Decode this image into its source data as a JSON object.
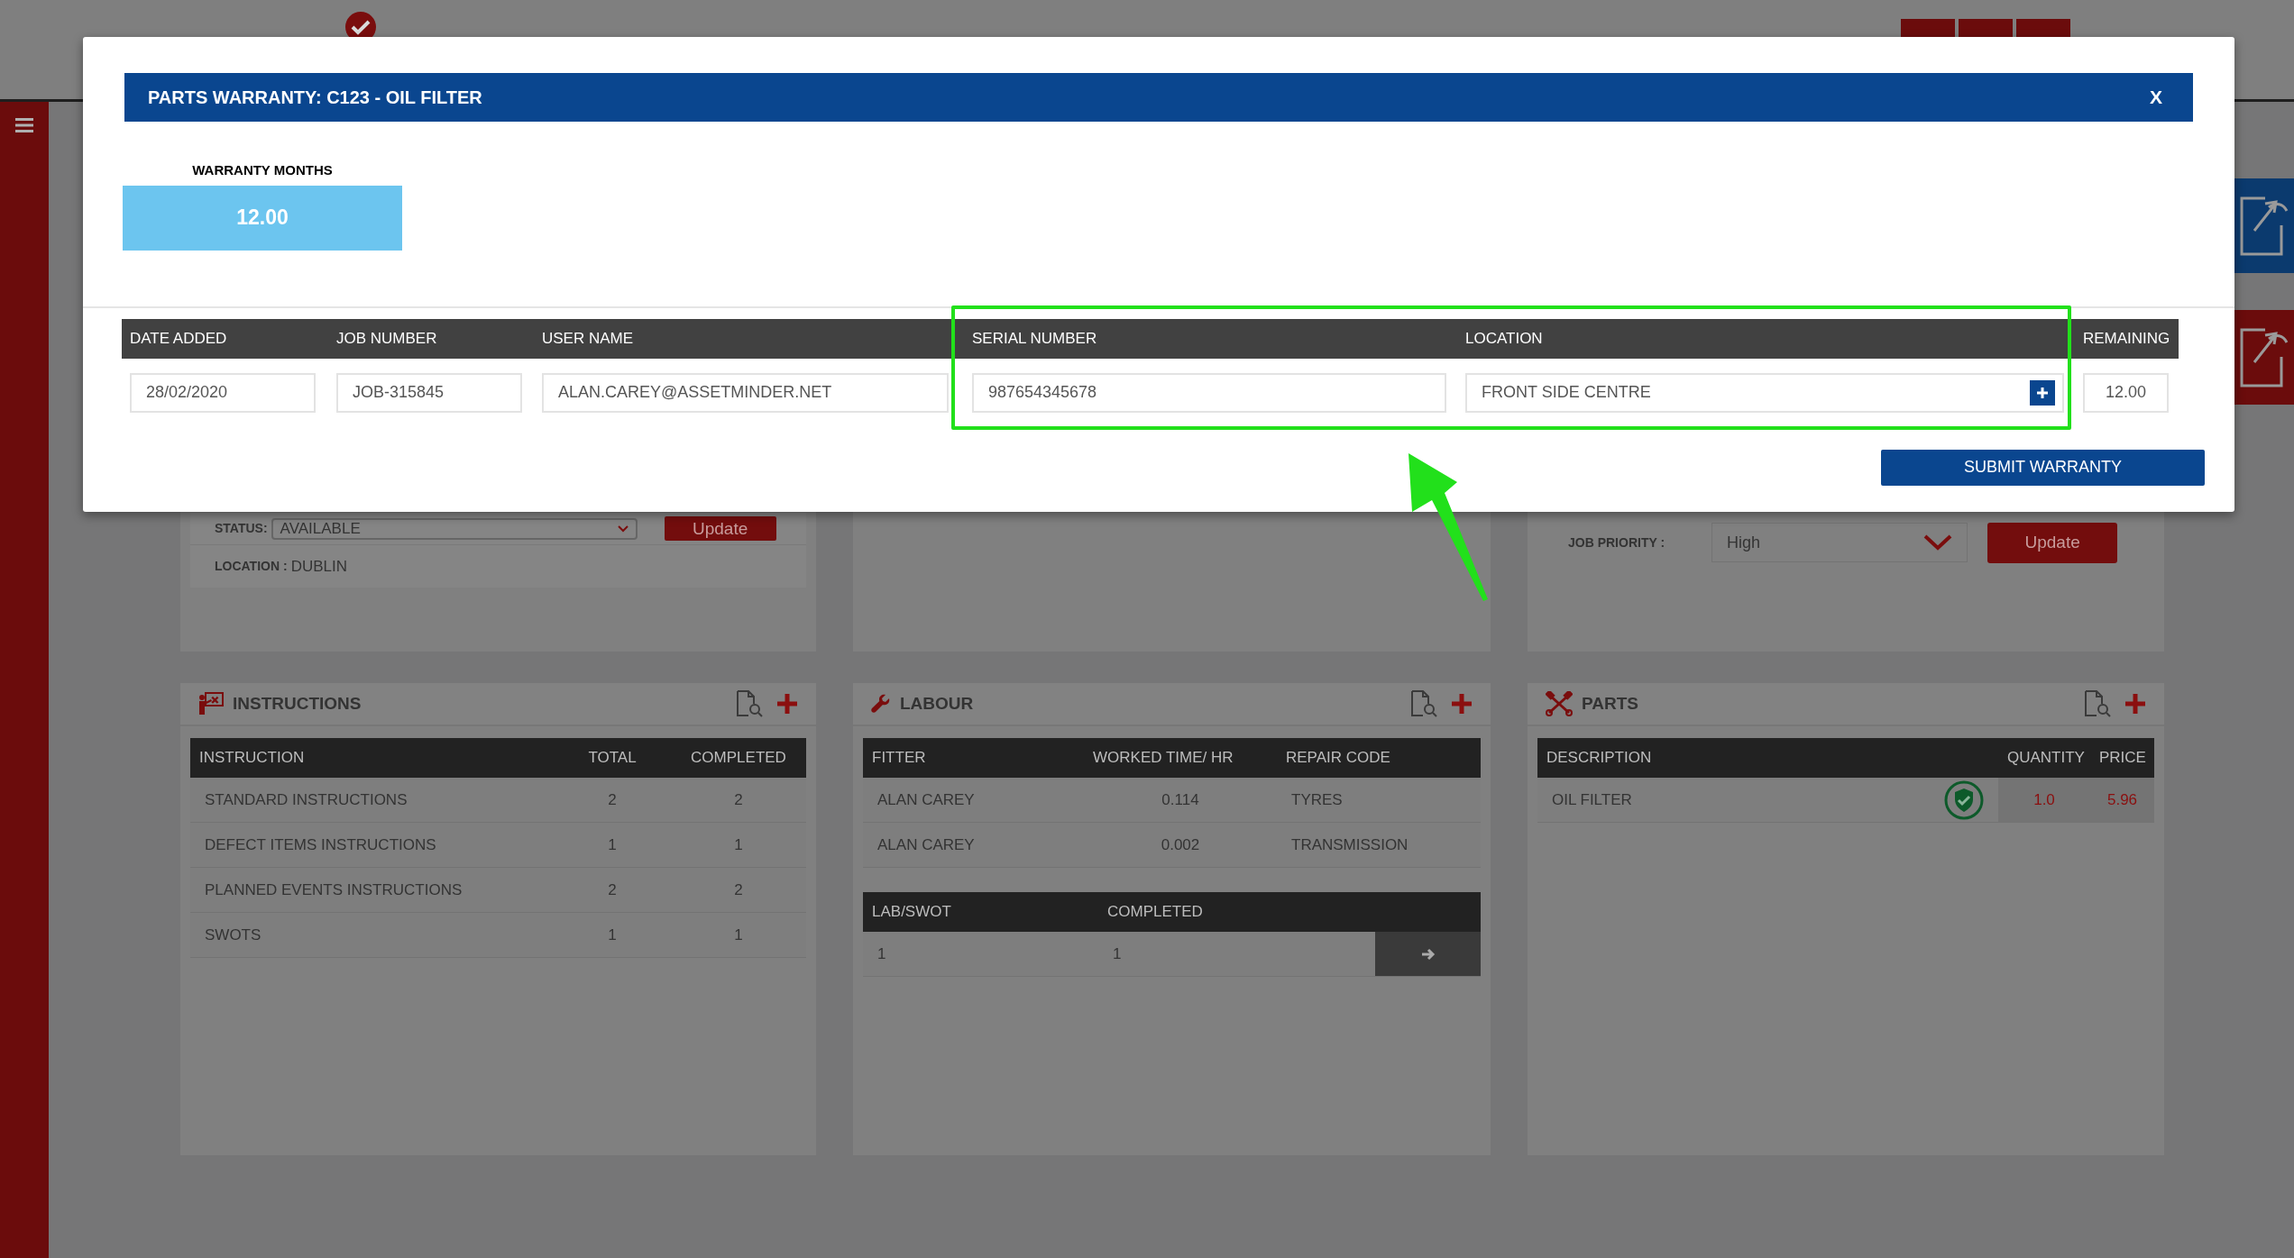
{
  "modal": {
    "title": "PARTS WARRANTY: C123 - OIL FILTER",
    "close": "X",
    "warranty_months": {
      "label": "WARRANTY MONTHS",
      "value": "12.00"
    },
    "columns": [
      "DATE ADDED",
      "JOB NUMBER",
      "USER NAME",
      "SERIAL NUMBER",
      "LOCATION",
      "REMAINING"
    ],
    "values": [
      "28/02/2020",
      "JOB-315845",
      "ALAN.CAREY@ASSETMINDER.NET",
      "987654345678",
      "FRONT SIDE CENTRE",
      "12.00"
    ],
    "submit": "SUBMIT WARRANTY"
  },
  "asset_panel": {
    "status_label": "STATUS:",
    "status": "AVAILABLE",
    "update": "Update",
    "location_label": "LOCATION :",
    "location": "DUBLIN"
  },
  "job_panel": {
    "priority_label": "JOB PRIORITY :",
    "priority": "High",
    "update": "Update"
  },
  "panels": [
    {
      "kind": "instructions",
      "title": "INSTRUCTIONS",
      "tables": [
        {
          "columns": [
            "INSTRUCTION",
            "TOTAL",
            "COMPLETED"
          ],
          "rows": [
            {
              "cells": [
                "STANDARD INSTRUCTIONS",
                "2",
                "2"
              ]
            },
            {
              "cells": [
                "DEFECT ITEMS INSTRUCTIONS",
                "1",
                "1"
              ]
            },
            {
              "cells": [
                "PLANNED EVENTS INSTRUCTIONS",
                "2",
                "2"
              ]
            },
            {
              "cells": [
                "SWOTS",
                "1",
                "1"
              ]
            }
          ]
        }
      ]
    },
    {
      "kind": "labour",
      "title": "LABOUR",
      "tables": [
        {
          "columns": [
            "FITTER",
            "WORKED TIME/ HR",
            "REPAIR CODE"
          ],
          "rows": [
            {
              "cells": [
                "ALAN CAREY",
                "0.114",
                "TYRES"
              ]
            },
            {
              "cells": [
                "ALAN CAREY",
                "0.002",
                "TRANSMISSION"
              ]
            }
          ]
        },
        {
          "columns": [
            "LAB/SWOT",
            "COMPLETED"
          ],
          "rows": [
            {
              "cells": [
                "1",
                "1"
              ]
            }
          ]
        }
      ]
    },
    {
      "kind": "parts",
      "title": "PARTS",
      "tables": [
        {
          "columns": [
            "DESCRIPTION",
            "QUANTITY",
            "PRICE"
          ],
          "rows": [
            {
              "cells": [
                "OIL FILTER",
                "1.0",
                "5.96"
              ],
              "warranty": true
            }
          ]
        }
      ]
    }
  ]
}
